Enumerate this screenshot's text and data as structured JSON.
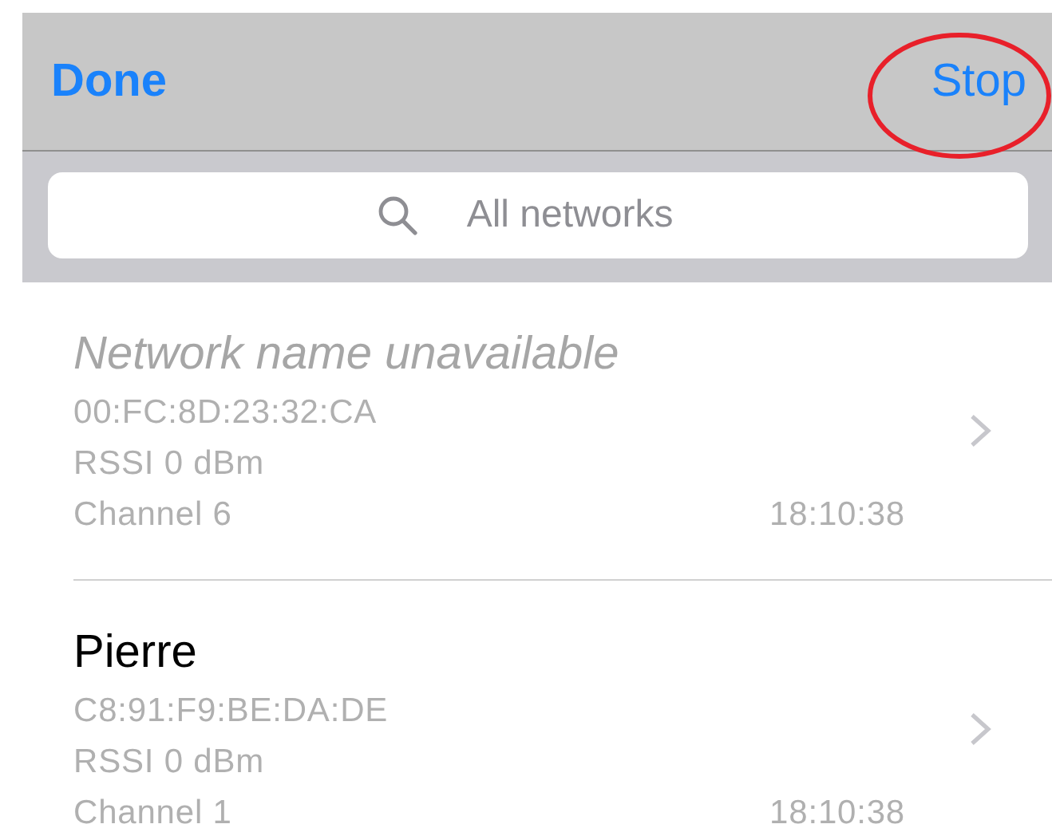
{
  "nav_bar": {
    "left_button": "Done",
    "right_button": "Stop",
    "annotation": {
      "kind": "circle",
      "color": "#e8202a"
    }
  },
  "search": {
    "placeholder": "All networks"
  },
  "networks": [
    {
      "name": "Network name unavailable",
      "name_unavailable": true,
      "bssid": "00:FC:8D:23:32:CA",
      "rssi": "RSSI 0 dBm",
      "channel": "Channel 6",
      "time": "18:10:38"
    },
    {
      "name": "Pierre",
      "name_unavailable": false,
      "bssid": "C8:91:F9:BE:DA:DE",
      "rssi": "RSSI 0 dBm",
      "channel": "Channel 1",
      "time": "18:10:38"
    }
  ]
}
